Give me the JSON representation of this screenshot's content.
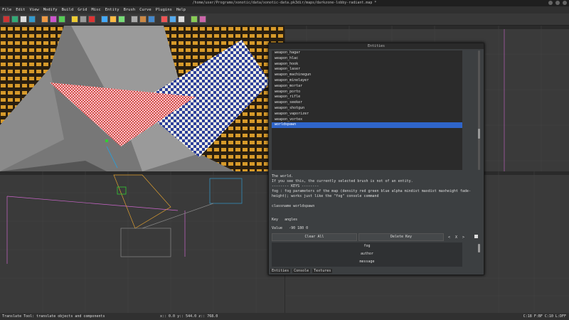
{
  "window": {
    "title": "/home/user/Programs/xonotic/data/xonotic-data.pk3dir/maps/darkzone-lobby-radiant.map *"
  },
  "menu": [
    "File",
    "Edit",
    "View",
    "Modify",
    "Build",
    "Grid",
    "Misc",
    "Entity",
    "Brush",
    "Curve",
    "Plugins",
    "Help"
  ],
  "entity_window": {
    "title": "Entities",
    "classes": [
      "weapon_hagar",
      "weapon_hlac",
      "weapon_hook",
      "weapon_laser",
      "weapon_machinegun",
      "weapon_minelayer",
      "weapon_mortar",
      "weapon_porto",
      "weapon_rifle",
      "weapon_seeker",
      "weapon_shotgun",
      "weapon_vaporizer",
      "weapon_vortex",
      "worldspawn"
    ],
    "selected": "worldspawn",
    "description": [
      "The world.",
      "If you see this, the currently selected brush is not of an entity.",
      "-------- KEYS --------",
      "fog : fog parameters of the map (density red green blue alpha mindist maxdist maxheight fade-height); works just like the \"fog\" console command",
      "",
      "classname   worldspawn"
    ],
    "key_label": "Key",
    "key_value": "angles",
    "value_label": "Value",
    "value_value": "-90 180 0",
    "clear_all": "Clear All",
    "delete_key": "Delete Key",
    "angle_btns": [
      "<",
      "X",
      ">"
    ],
    "props": [
      "fog",
      "author",
      "message"
    ],
    "tabs": [
      "Entities",
      "Console",
      "Textures"
    ]
  },
  "status": {
    "text": "Translate Tool: translate objects and components",
    "coords": [
      "x::  0.0  y::  544.0  z::  768.0"
    ],
    "right": "C:18  F:BF  C:10  L:DFF"
  },
  "colors": {
    "selection": "#2f65ca",
    "window": "#3c3f41"
  }
}
